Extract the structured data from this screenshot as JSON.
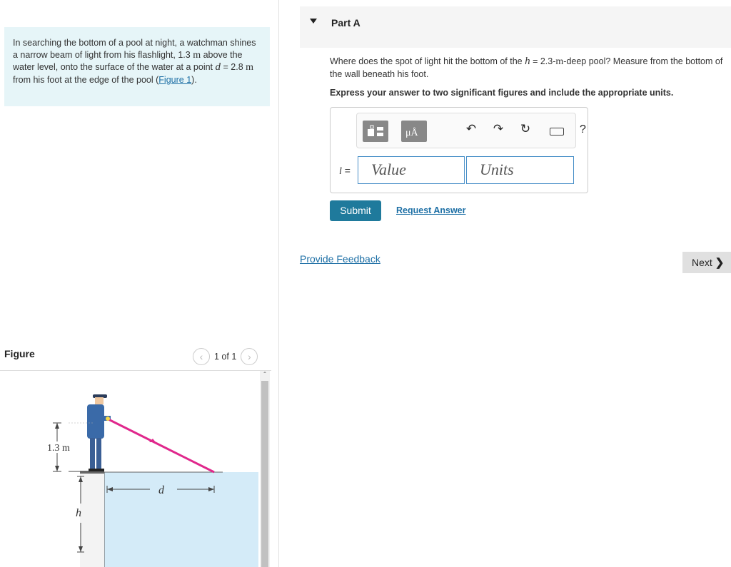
{
  "problem": {
    "text_1": "In searching the bottom of a pool at night, a watchman shines a narrow beam of light from his flashlight, 1.3",
    "unit_m": "m",
    "text_2": "above the water level, onto the surface of the water at a point",
    "var_d": "d",
    "text_3": "= 2.8",
    "text_4": "from his foot at the edge of the pool (",
    "link": "Figure 1",
    "text_5": ")."
  },
  "figure_panel": {
    "title": "Figure",
    "pager_text": "1 of 1",
    "prev_icon": "chevron-left-icon",
    "next_icon": "chevron-right-icon",
    "labels": {
      "height": "1.3 m",
      "d": "d",
      "h": "h"
    }
  },
  "part": {
    "title": "Part A"
  },
  "question": {
    "text_1": "Where does the spot of light hit the bottom of the",
    "var_h": "h",
    "text_2": "= 2.3-",
    "unit_m": "m",
    "text_3": "-deep pool? Measure from the bottom of the wall beneath his foot.",
    "instruction": "Express your answer to two significant figures and include the appropriate units."
  },
  "answer": {
    "label_var": "l",
    "label_eq": " =",
    "value_placeholder": "Value",
    "units_placeholder": "Units",
    "toolbar": {
      "units_glyph": "μÅ",
      "undo": "↶",
      "redo": "↷",
      "reset": "↻",
      "help": "?"
    }
  },
  "buttons": {
    "submit": "Submit",
    "request": "Request Answer",
    "feedback": "Provide Feedback",
    "next": "Next",
    "next_chevron": "❯"
  },
  "colors": {
    "problem_bg": "#e6f5f8",
    "accent": "#1f7a9c",
    "link": "#1d6fa5",
    "beam": "#e0288c",
    "water": "#d4ebf8"
  }
}
